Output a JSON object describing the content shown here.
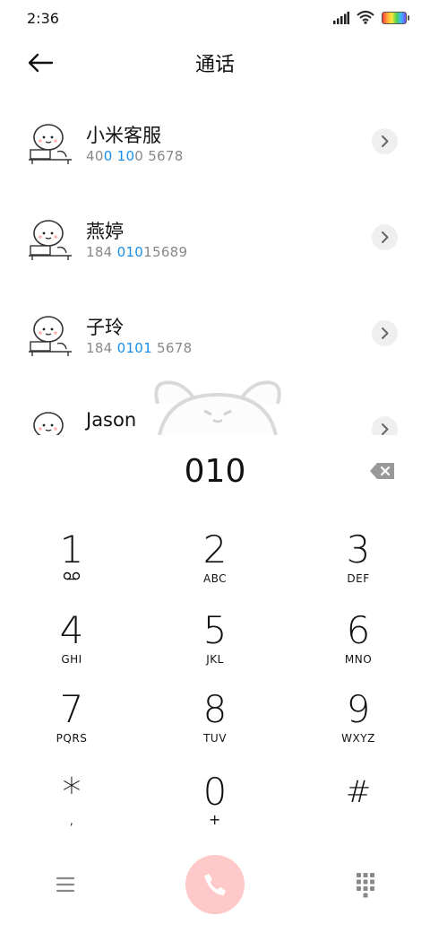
{
  "status_bar": {
    "time": "2:36"
  },
  "header": {
    "title": "通话"
  },
  "contacts": [
    {
      "name": "小米客服",
      "number_parts": [
        "40",
        "0 10",
        "0 5678"
      ]
    },
    {
      "name": "燕婷",
      "number_parts": [
        "184 ",
        "010",
        "15689"
      ]
    },
    {
      "name": "子玲",
      "number_parts": [
        "184 ",
        "0101",
        " 5678"
      ]
    },
    {
      "name": "Jason",
      "number_parts": [
        "",
        "",
        ""
      ]
    }
  ],
  "dialed_number": "010",
  "keypad": [
    {
      "digit": "1",
      "letters": ""
    },
    {
      "digit": "2",
      "letters": "ABC"
    },
    {
      "digit": "3",
      "letters": "DEF"
    },
    {
      "digit": "4",
      "letters": "GHI"
    },
    {
      "digit": "5",
      "letters": "JKL"
    },
    {
      "digit": "6",
      "letters": "MNO"
    },
    {
      "digit": "7",
      "letters": "PQRS"
    },
    {
      "digit": "8",
      "letters": "TUV"
    },
    {
      "digit": "9",
      "letters": "WXYZ"
    },
    {
      "digit": "*",
      "letters": ","
    },
    {
      "digit": "0",
      "letters": "+"
    },
    {
      "digit": "#",
      "letters": ""
    }
  ],
  "icons": {
    "back": "arrow-left-icon",
    "backspace": "backspace-icon",
    "voicemail": "voicemail-icon",
    "menu": "menu-icon",
    "call": "phone-icon",
    "keypad": "dialpad-icon"
  },
  "colors": {
    "highlight": "#1a8ee8",
    "call_button": "#ffc9c9"
  }
}
